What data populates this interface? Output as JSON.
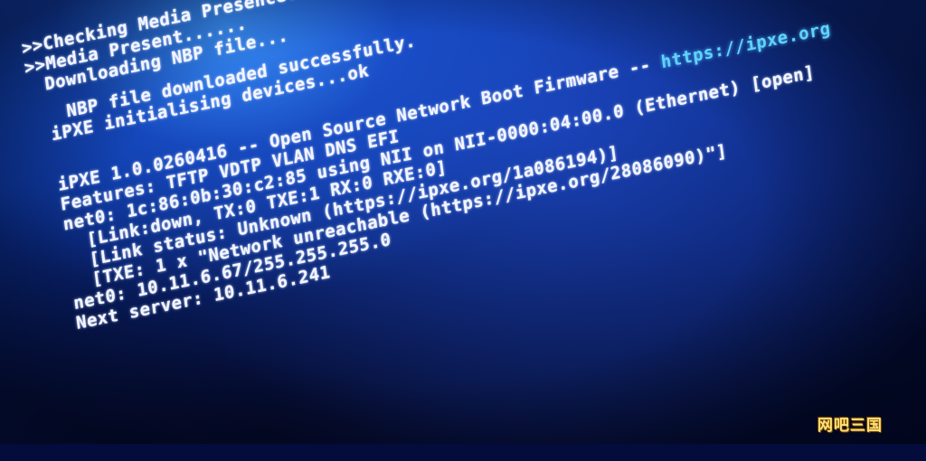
{
  "console_lines": [
    ">>Checking Media Presence......",
    ">>Media Present......",
    "Downloading NBP file...",
    "NBP file downloaded successfully.",
    "iPXE initialising devices...ok",
    "iPXE 1.0.0260416 -- Open Source Network Boot Firmware -- ",
    "Features: TFTP VDTP VLAN DNS EFI",
    "net0: 1c:86:0b:30:c2:85 using NII on NII-0000:04:00.0 (Ethernet) [open]",
    "  [Link:down, TX:0 TXE:1 RX:0 RXE:0]",
    "  [Link status: Unknown (https://ipxe.org/1a086194)]",
    "  [TXE: 1 x \"Network unreachable (https://ipxe.org/28086090)\"]",
    "net0: 10.11.6.67/255.255.255.0",
    "Next server: 10.11.6.241"
  ],
  "ipxe_url": "https://ipxe.org",
  "watermark": "网吧三国",
  "colors": {
    "text": "#f2f4ff",
    "link": "#5fd4ff",
    "watermark": "#ffe27a"
  }
}
